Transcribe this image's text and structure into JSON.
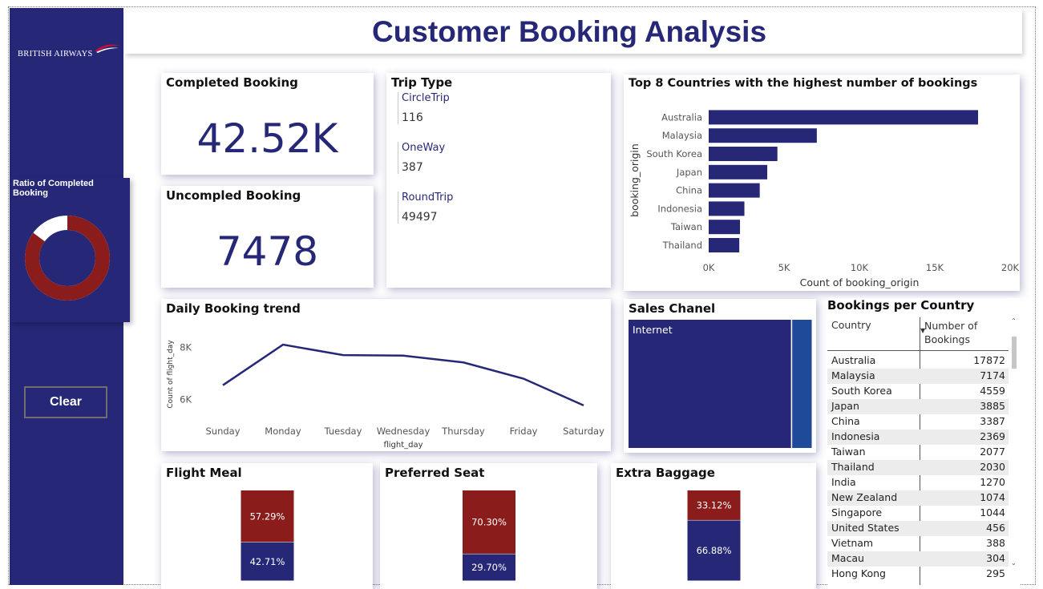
{
  "header": {
    "title": "Customer Booking Analysis"
  },
  "brand": {
    "name": "BRITISH AIRWAYS",
    "primary_color": "#262877",
    "accent_color": "#8b1c1c"
  },
  "sidebar": {
    "ratio_title": "Ratio of Completed Booking",
    "ratio_completed": 0.85,
    "clear_label": "Clear"
  },
  "completed_booking": {
    "title": "Completed Booking",
    "value": "42.52K"
  },
  "uncompleted_booking": {
    "title": "Uncompled Booking",
    "value": "7478"
  },
  "trip_type": {
    "title": "Trip Type",
    "items": [
      {
        "label": "CircleTrip",
        "value": "116"
      },
      {
        "label": "OneWay",
        "value": "387"
      },
      {
        "label": "RoundTrip",
        "value": "49497"
      }
    ]
  },
  "top_countries": {
    "chart_data": {
      "type": "bar",
      "orientation": "horizontal",
      "title": "Top 8 Countries with the highest number of bookings",
      "categories": [
        "Australia",
        "Malaysia",
        "South Korea",
        "Japan",
        "China",
        "Indonesia",
        "Taiwan",
        "Thailand"
      ],
      "values": [
        17872,
        7174,
        4559,
        3885,
        3387,
        2369,
        2077,
        2030
      ],
      "xlabel": "Count of booking_origin",
      "ylabel": "booking_origin",
      "xlim": [
        0,
        20000
      ],
      "xticks": [
        "0K",
        "5K",
        "10K",
        "15K",
        "20K"
      ],
      "color": "#262877"
    }
  },
  "daily_trend": {
    "chart_data": {
      "type": "line",
      "title": "Daily Booking trend",
      "categories": [
        "Sunday",
        "Monday",
        "Tuesday",
        "Wednesday",
        "Thursday",
        "Friday",
        "Saturday"
      ],
      "values": [
        6550,
        8100,
        7700,
        7680,
        7420,
        6800,
        5780
      ],
      "xlabel": "flight_day",
      "ylabel": "Count of flight_day",
      "ylim": [
        5500,
        8500
      ],
      "yticks": [
        {
          "v": 8000,
          "label": "8K"
        },
        {
          "v": 6000,
          "label": "6K"
        }
      ],
      "color": "#262877"
    }
  },
  "sales_channel": {
    "chart_data": {
      "type": "treemap",
      "title": "Sales Chanel",
      "items": [
        {
          "label": "Internet",
          "value": 44382,
          "color": "#262877"
        },
        {
          "label": "",
          "value": 5618,
          "color": "#1f4a9a"
        }
      ]
    }
  },
  "stacked_cards": [
    {
      "chart_data": {
        "type": "bar",
        "stacked": true,
        "title": "Flight Meal",
        "series": [
          {
            "label": "42.71%",
            "value": 42.71,
            "color": "#262877"
          },
          {
            "label": "57.29%",
            "value": 57.29,
            "color": "#8b1c1c"
          }
        ]
      }
    },
    {
      "chart_data": {
        "type": "bar",
        "stacked": true,
        "title": "Preferred Seat",
        "series": [
          {
            "label": "29.70%",
            "value": 29.7,
            "color": "#262877"
          },
          {
            "label": "70.30%",
            "value": 70.3,
            "color": "#8b1c1c"
          }
        ]
      }
    },
    {
      "chart_data": {
        "type": "bar",
        "stacked": true,
        "title": "Extra Baggage",
        "series": [
          {
            "label": "66.88%",
            "value": 66.88,
            "color": "#262877"
          },
          {
            "label": "33.12%",
            "value": 33.12,
            "color": "#8b1c1c"
          }
        ]
      }
    }
  ],
  "bookings_table": {
    "title": "Bookings per Country",
    "col_country": "Country",
    "col_number": "Number of Bookings",
    "rows": [
      {
        "country": "Australia",
        "count": "17872"
      },
      {
        "country": "Malaysia",
        "count": "7174"
      },
      {
        "country": "South Korea",
        "count": "4559"
      },
      {
        "country": "Japan",
        "count": "3885"
      },
      {
        "country": "China",
        "count": "3387"
      },
      {
        "country": "Indonesia",
        "count": "2369"
      },
      {
        "country": "Taiwan",
        "count": "2077"
      },
      {
        "country": "Thailand",
        "count": "2030"
      },
      {
        "country": "India",
        "count": "1270"
      },
      {
        "country": "New Zealand",
        "count": "1074"
      },
      {
        "country": "Singapore",
        "count": "1044"
      },
      {
        "country": "United States",
        "count": "456"
      },
      {
        "country": "Vietnam",
        "count": "388"
      },
      {
        "country": "Macau",
        "count": "304"
      },
      {
        "country": "Hong Kong",
        "count": "295"
      }
    ]
  }
}
